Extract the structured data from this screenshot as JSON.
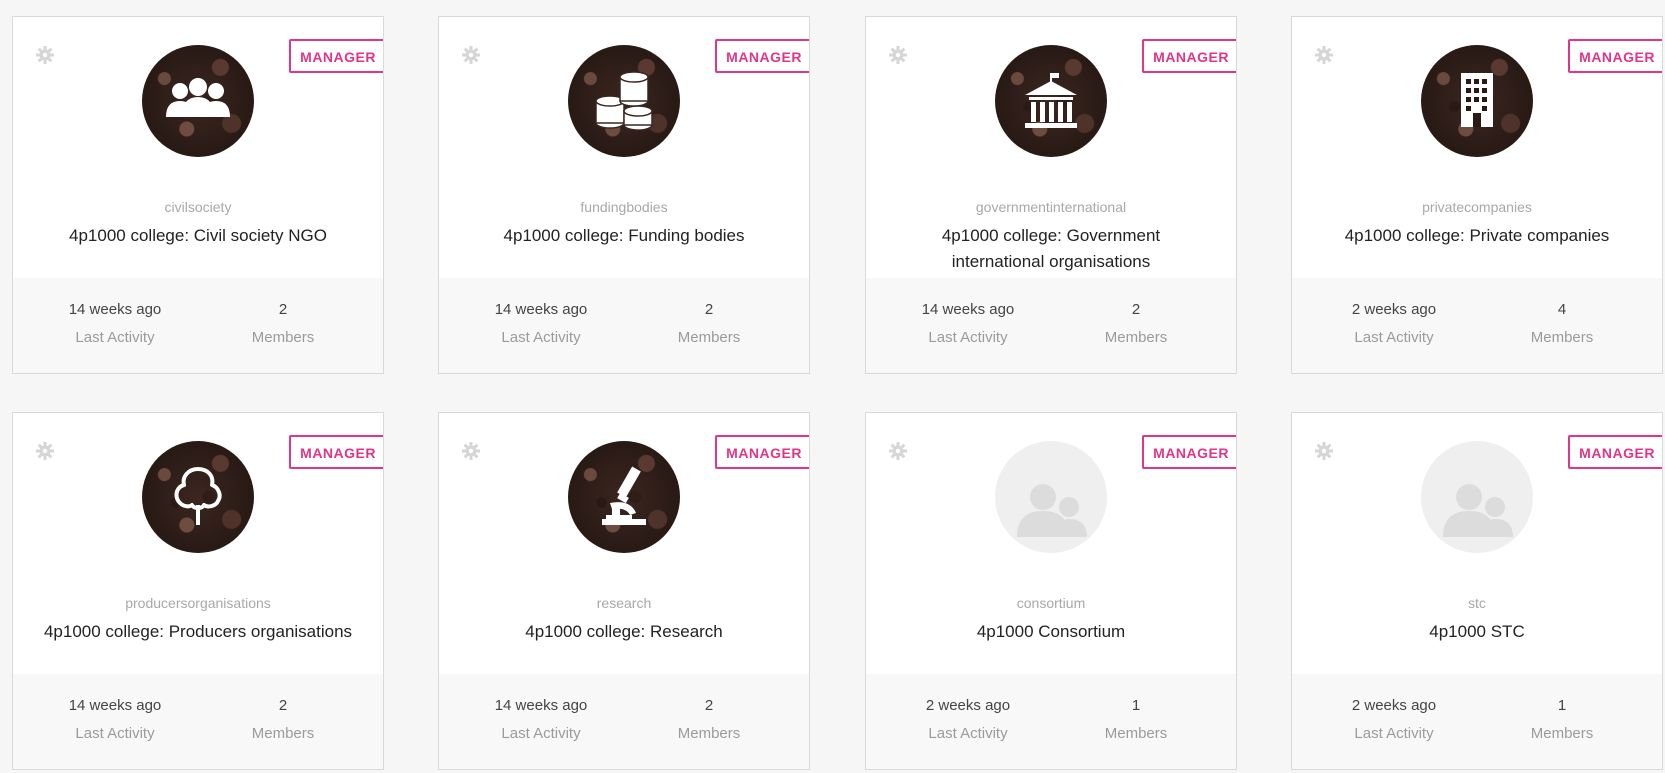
{
  "groups": [
    {
      "slug": "civilsociety",
      "title": "4p1000 college: Civil society NGO",
      "badge": "MANAGER",
      "last_activity": "14 weeks ago",
      "last_activity_label": "Last Activity",
      "members": "2",
      "members_label": "Members",
      "icon": "people-group-icon",
      "avatar_style": "soil"
    },
    {
      "slug": "fundingbodies",
      "title": "4p1000 college: Funding bodies",
      "badge": "MANAGER",
      "last_activity": "14 weeks ago",
      "last_activity_label": "Last Activity",
      "members": "2",
      "members_label": "Members",
      "icon": "coins-stack-icon",
      "avatar_style": "soil"
    },
    {
      "slug": "governmentinternational",
      "title": "4p1000 college: Government international organisations",
      "badge": "MANAGER",
      "last_activity": "14 weeks ago",
      "last_activity_label": "Last Activity",
      "members": "2",
      "members_label": "Members",
      "icon": "government-building-icon",
      "avatar_style": "soil"
    },
    {
      "slug": "privatecompanies",
      "title": "4p1000 college: Private companies",
      "badge": "MANAGER",
      "last_activity": "2 weeks ago",
      "last_activity_label": "Last Activity",
      "members": "4",
      "members_label": "Members",
      "icon": "office-building-icon",
      "avatar_style": "soil"
    },
    {
      "slug": "producersorganisations",
      "title": "4p1000 college: Producers organisations",
      "badge": "MANAGER",
      "last_activity": "14 weeks ago",
      "last_activity_label": "Last Activity",
      "members": "2",
      "members_label": "Members",
      "icon": "tree-icon",
      "avatar_style": "soil"
    },
    {
      "slug": "research",
      "title": "4p1000 college: Research",
      "badge": "MANAGER",
      "last_activity": "14 weeks ago",
      "last_activity_label": "Last Activity",
      "members": "2",
      "members_label": "Members",
      "icon": "microscope-icon",
      "avatar_style": "soil"
    },
    {
      "slug": "consortium",
      "title": "4p1000 Consortium",
      "badge": "MANAGER",
      "last_activity": "2 weeks ago",
      "last_activity_label": "Last Activity",
      "members": "1",
      "members_label": "Members",
      "icon": "default-group-icon",
      "avatar_style": "placeholder"
    },
    {
      "slug": "stc",
      "title": "4p1000 STC",
      "badge": "MANAGER",
      "last_activity": "2 weeks ago",
      "last_activity_label": "Last Activity",
      "members": "1",
      "members_label": "Members",
      "icon": "default-group-icon",
      "avatar_style": "placeholder"
    }
  ],
  "colors": {
    "badge": "#e0368a",
    "gear": "#d6d6d6",
    "placeholder_icon": "#dcdcdc"
  }
}
